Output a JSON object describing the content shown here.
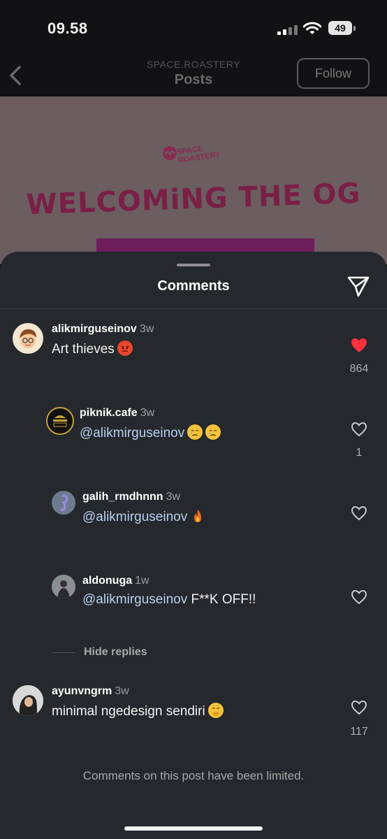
{
  "status_bar": {
    "time": "09.58",
    "battery": "49"
  },
  "header": {
    "account": "SPACE.ROASTERY",
    "title": "Posts",
    "follow_label": "Follow"
  },
  "post_preview": {
    "brand": "SPACE ROASTERY",
    "headline": "WELCOMiNG THE OG"
  },
  "sheet": {
    "title": "Comments"
  },
  "comments": [
    {
      "username": "alikmirguseinov",
      "age": "3w",
      "text": "Art thieves",
      "emoji": "angry-face",
      "likes": "864",
      "liked": true
    },
    {
      "username": "piknik.cafe",
      "age": "3w",
      "mention": "@alikmirguseinov",
      "text": "",
      "emoji": "crying-face x2",
      "likes": "1",
      "liked": false
    },
    {
      "username": "galih_rmdhnnn",
      "age": "3w",
      "mention": "@alikmirguseinov",
      "text": "",
      "emoji": "fire",
      "likes": "",
      "liked": false
    },
    {
      "username": "aldonuga",
      "age": "1w",
      "mention": "@alikmirguseinov",
      "text": "F**K OFF!!",
      "likes": "",
      "liked": false
    },
    {
      "username": "ayunvngrm",
      "age": "3w",
      "text": "minimal ngedesign sendiri",
      "emoji": "hand-over-mouth-face",
      "likes": "117",
      "liked": false
    }
  ],
  "hide_replies_label": "Hide replies",
  "footer_notice": "Comments on this post have been limited.",
  "colors": {
    "sheet_bg": "#25282c",
    "mention": "#b9cff0",
    "like_red": "#ff3040"
  }
}
